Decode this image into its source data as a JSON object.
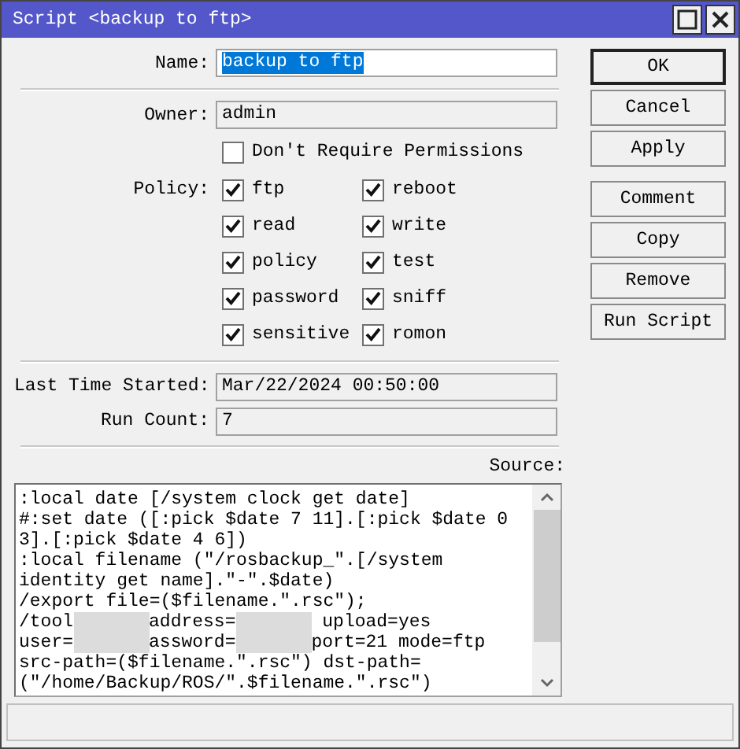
{
  "window": {
    "title": "Script <backup to ftp>"
  },
  "name": {
    "label": "Name:",
    "value": "backup to ftp",
    "selected": true
  },
  "owner": {
    "label": "Owner:",
    "value": "admin"
  },
  "dont_require_permissions": {
    "label": "Don't Require Permissions",
    "checked": false
  },
  "policy": {
    "label": "Policy:",
    "items": [
      {
        "label": "ftp",
        "checked": true
      },
      {
        "label": "reboot",
        "checked": true
      },
      {
        "label": "read",
        "checked": true
      },
      {
        "label": "write",
        "checked": true
      },
      {
        "label": "policy",
        "checked": true
      },
      {
        "label": "test",
        "checked": true
      },
      {
        "label": "password",
        "checked": true
      },
      {
        "label": "sniff",
        "checked": true
      },
      {
        "label": "sensitive",
        "checked": true
      },
      {
        "label": "romon",
        "checked": true
      }
    ]
  },
  "last_time_started": {
    "label": "Last Time Started:",
    "value": "Mar/22/2024 00:50:00"
  },
  "run_count": {
    "label": "Run Count:",
    "value": "7"
  },
  "source": {
    "label": "Source:",
    "lines": [
      [
        {
          "kind": "text",
          "text": ":local date [/system clock get date]"
        }
      ],
      [
        {
          "kind": "text",
          "text": "#:set date ([:pick $date 7 11].[:pick $date 0"
        }
      ],
      [
        {
          "kind": "text",
          "text": "3].[:pick $date 4 6])"
        }
      ],
      [
        {
          "kind": "text",
          "text": ":local filename (\"/rosbackup_\".[/system"
        }
      ],
      [
        {
          "kind": "text",
          "text": "identity get name].\"-\".$date)"
        }
      ],
      [
        {
          "kind": "text",
          "text": "/export file=($filename.\".rsc\");"
        }
      ],
      [
        {
          "kind": "text",
          "text": "/tool"
        },
        {
          "kind": "redacted"
        },
        {
          "kind": "text",
          "text": "address="
        },
        {
          "kind": "redacted"
        },
        {
          "kind": "text",
          "text": " upload=yes"
        }
      ],
      [
        {
          "kind": "text",
          "text": "user="
        },
        {
          "kind": "redacted"
        },
        {
          "kind": "text",
          "text": "assword="
        },
        {
          "kind": "redacted"
        },
        {
          "kind": "text",
          "text": "port=21 mode=ftp"
        }
      ],
      [
        {
          "kind": "text",
          "text": "src-path=($filename.\".rsc\") dst-path="
        }
      ],
      [
        {
          "kind": "text",
          "text": "(\"/home/Backup/ROS/\".$filename.\".rsc\")"
        }
      ]
    ]
  },
  "buttons": [
    {
      "label": "OK",
      "default": true
    },
    {
      "label": "Cancel",
      "default": false
    },
    {
      "label": "Apply",
      "default": false
    },
    {
      "label": "Comment",
      "default": false
    },
    {
      "label": "Copy",
      "default": false
    },
    {
      "label": "Remove",
      "default": false
    },
    {
      "label": "Run Script",
      "default": false
    }
  ]
}
